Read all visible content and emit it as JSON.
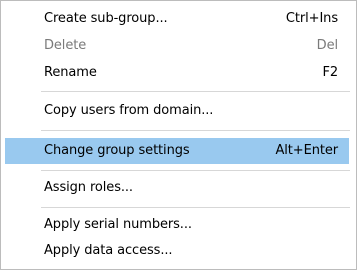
{
  "menu": {
    "items": [
      {
        "label": "Create sub-group...",
        "shortcut": "Ctrl+Ins",
        "enabled": true,
        "highlighted": false
      },
      {
        "label": "Delete",
        "shortcut": "Del",
        "enabled": false,
        "highlighted": false
      },
      {
        "label": "Rename",
        "shortcut": "F2",
        "enabled": true,
        "highlighted": false
      },
      {
        "label": "Copy users from domain...",
        "shortcut": "",
        "enabled": true,
        "highlighted": false
      },
      {
        "label": "Change group settings",
        "shortcut": "Alt+Enter",
        "enabled": true,
        "highlighted": true
      },
      {
        "label": "Assign roles...",
        "shortcut": "",
        "enabled": true,
        "highlighted": false
      },
      {
        "label": "Apply serial numbers...",
        "shortcut": "",
        "enabled": true,
        "highlighted": false
      },
      {
        "label": "Apply data access...",
        "shortcut": "",
        "enabled": true,
        "highlighted": false
      }
    ]
  },
  "colors": {
    "highlight": "#99c9ef",
    "disabled_text": "#7a7a7a",
    "separator": "#d7d7d7",
    "border": "#bcbcbc"
  }
}
